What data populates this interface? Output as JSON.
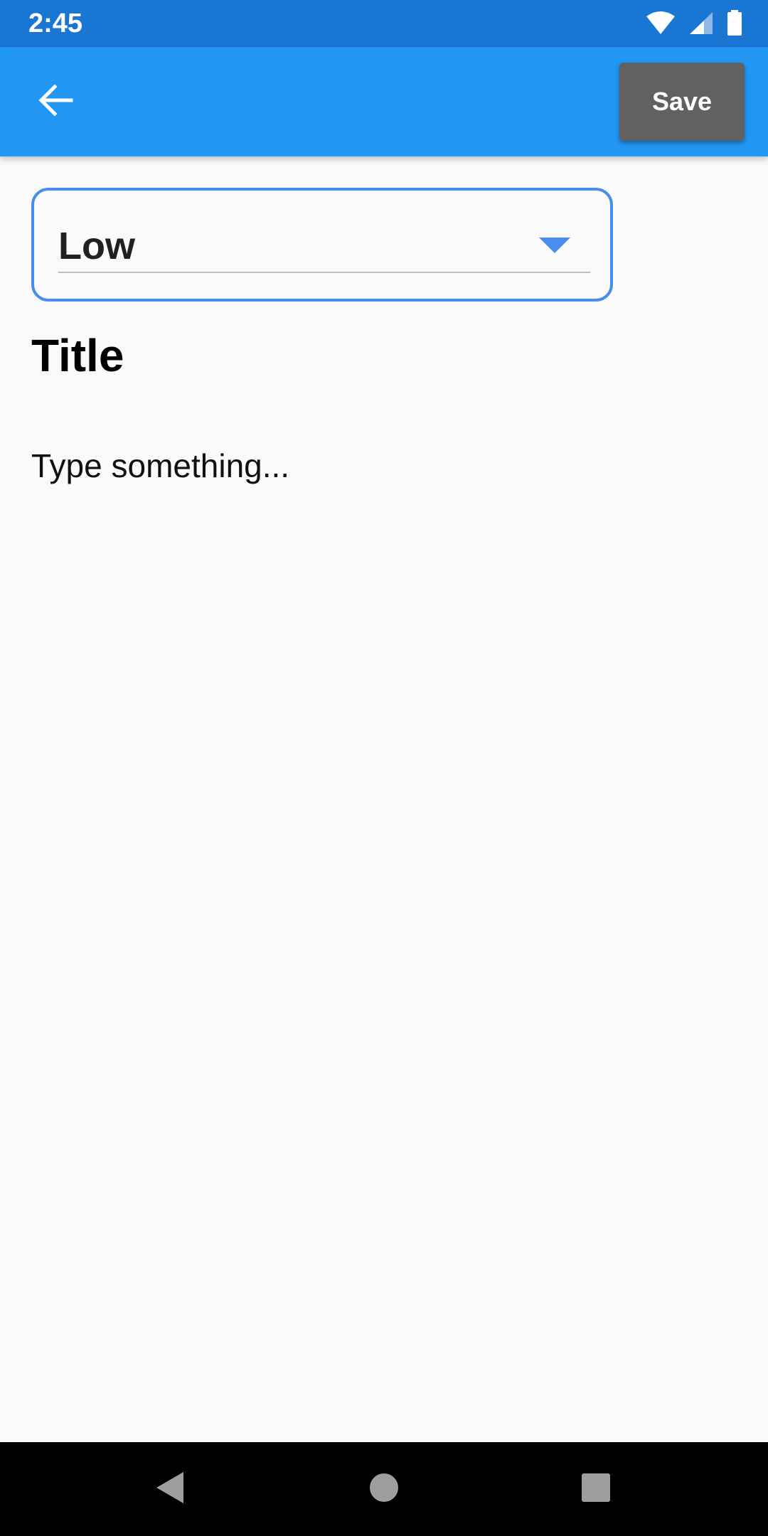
{
  "status_bar": {
    "time": "2:45",
    "icons": [
      "wifi-icon",
      "cell-signal-icon",
      "battery-icon"
    ],
    "color": "#1976d2"
  },
  "app_bar": {
    "back_icon": "arrow-back-icon",
    "save_label": "Save",
    "color": "#2196f3",
    "save_color": "#616161"
  },
  "form": {
    "priority": {
      "selected": "Low",
      "icon": "dropdown-arrow-icon",
      "accent": "#4a8ded"
    },
    "title_placeholder": "Title",
    "body_placeholder": "Type something..."
  },
  "nav_bar": {
    "icons": [
      "back-triangle-icon",
      "home-circle-icon",
      "recents-square-icon"
    ]
  }
}
